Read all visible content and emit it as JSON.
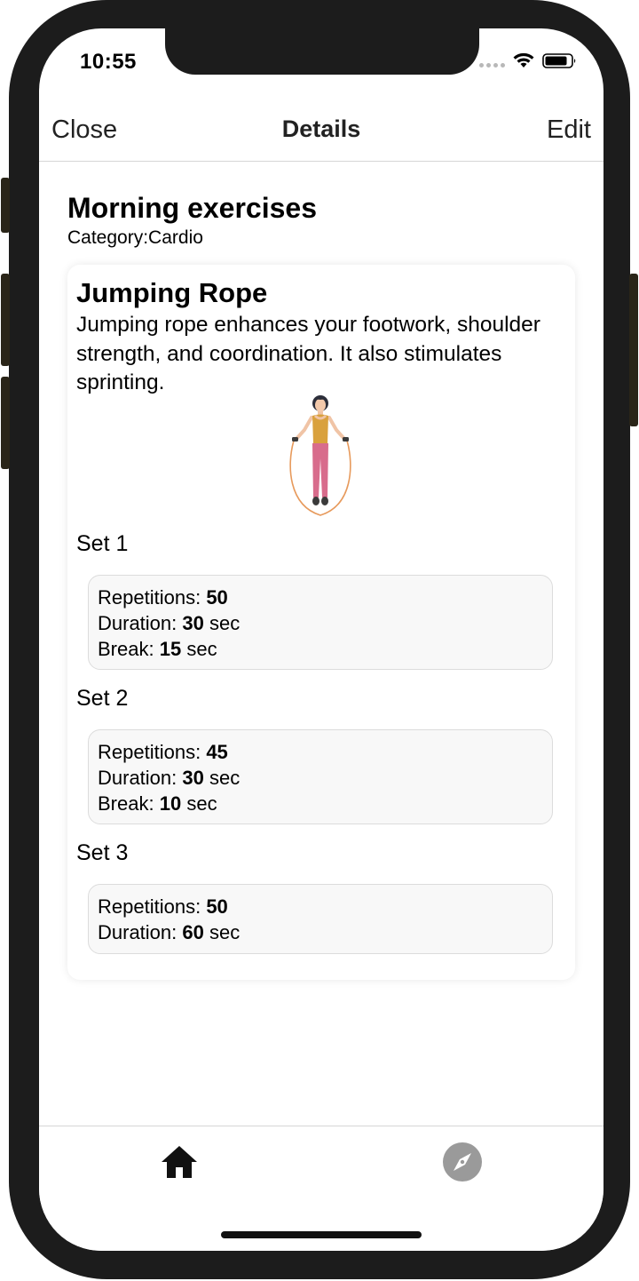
{
  "status_bar": {
    "time": "10:55"
  },
  "nav": {
    "close_label": "Close",
    "title": "Details",
    "edit_label": "Edit"
  },
  "workout": {
    "title": "Morning exercises",
    "category_label": "Category:",
    "category_value": "Cardio"
  },
  "exercise": {
    "name": "Jumping Rope",
    "description": "Jumping rope enhances your footwork, shoulder strength, and coordination. It also stimulates sprinting.",
    "illustration": "woman-jumping-rope-illustration"
  },
  "sets": [
    {
      "label": "Set 1",
      "repetitions_label": "Repetitions:",
      "repetitions": "50",
      "duration_label": "Duration:",
      "duration": "30",
      "duration_unit": "sec",
      "break_label": "Break:",
      "break": "15",
      "break_unit": "sec"
    },
    {
      "label": "Set 2",
      "repetitions_label": "Repetitions:",
      "repetitions": "45",
      "duration_label": "Duration:",
      "duration": "30",
      "duration_unit": "sec",
      "break_label": "Break:",
      "break": "10",
      "break_unit": "sec"
    },
    {
      "label": "Set 3",
      "repetitions_label": "Repetitions:",
      "repetitions": "50",
      "duration_label": "Duration:",
      "duration": "60",
      "duration_unit": "sec"
    }
  ],
  "tab_bar": {
    "items": [
      {
        "icon": "home-icon",
        "active": true
      },
      {
        "icon": "compass-icon",
        "active": false
      }
    ]
  },
  "colors": {
    "active_tab": "#111111",
    "inactive_tab": "#9a9a9a",
    "set_box_background": "#f8f8f8"
  }
}
